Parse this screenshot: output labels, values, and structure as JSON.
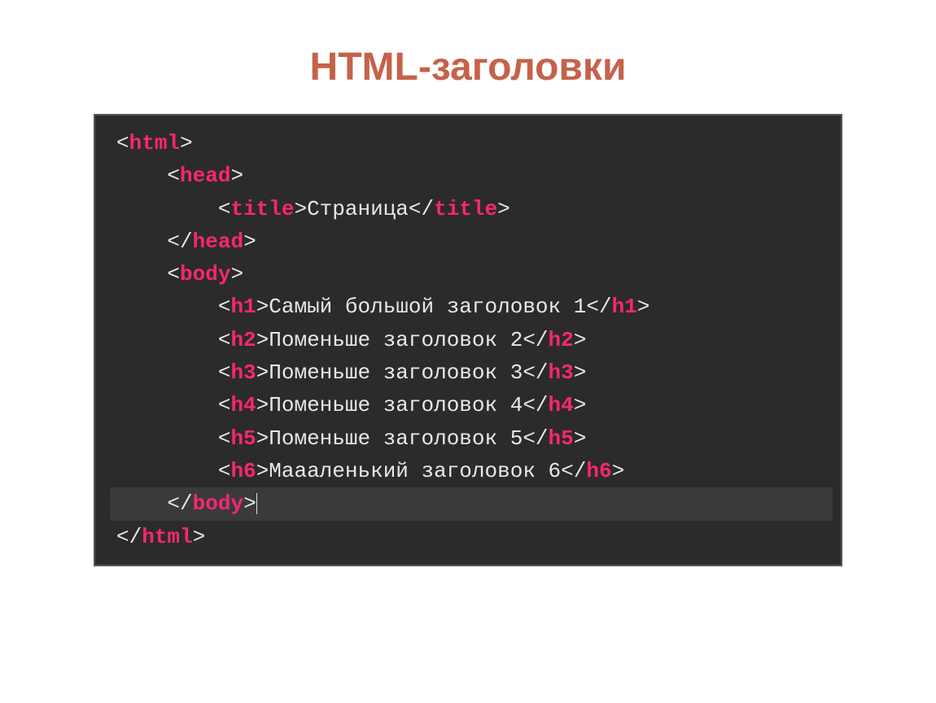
{
  "slide": {
    "title": "HTML-заголовки"
  },
  "code": {
    "lines": [
      {
        "indent": 0,
        "open": "html",
        "text": null,
        "close": null,
        "hl": false
      },
      {
        "indent": 1,
        "open": "head",
        "text": null,
        "close": null,
        "hl": false
      },
      {
        "indent": 2,
        "open": "title",
        "text": "Страница",
        "close": "title",
        "hl": false
      },
      {
        "indent": 1,
        "open": "/head",
        "text": null,
        "close": null,
        "hl": false
      },
      {
        "indent": 1,
        "open": "body",
        "text": null,
        "close": null,
        "hl": false
      },
      {
        "indent": 2,
        "open": "h1",
        "text": "Самый большой заголовок 1",
        "close": "h1",
        "hl": false
      },
      {
        "indent": 2,
        "open": "h2",
        "text": "Поменьше заголовок 2",
        "close": "h2",
        "hl": false
      },
      {
        "indent": 2,
        "open": "h3",
        "text": "Поменьше заголовок 3",
        "close": "h3",
        "hl": false
      },
      {
        "indent": 2,
        "open": "h4",
        "text": "Поменьше заголовок 4",
        "close": "h4",
        "hl": false
      },
      {
        "indent": 2,
        "open": "h5",
        "text": "Поменьше заголовок 5",
        "close": "h5",
        "hl": false
      },
      {
        "indent": 2,
        "open": "h6",
        "text": "Маааленький заголовок 6",
        "close": "h6",
        "hl": false
      },
      {
        "indent": 1,
        "open": "/body",
        "text": null,
        "close": null,
        "hl": true,
        "cursor": true
      },
      {
        "indent": 0,
        "open": "/html",
        "text": null,
        "close": null,
        "hl": false
      }
    ],
    "indent_unit": "    ",
    "colors": {
      "bracket": "#e8e8e8",
      "tag": "#f92672",
      "text": "#e8e8e8",
      "background": "#2b2b2b",
      "highlight_row": "#3a3a3a"
    }
  }
}
